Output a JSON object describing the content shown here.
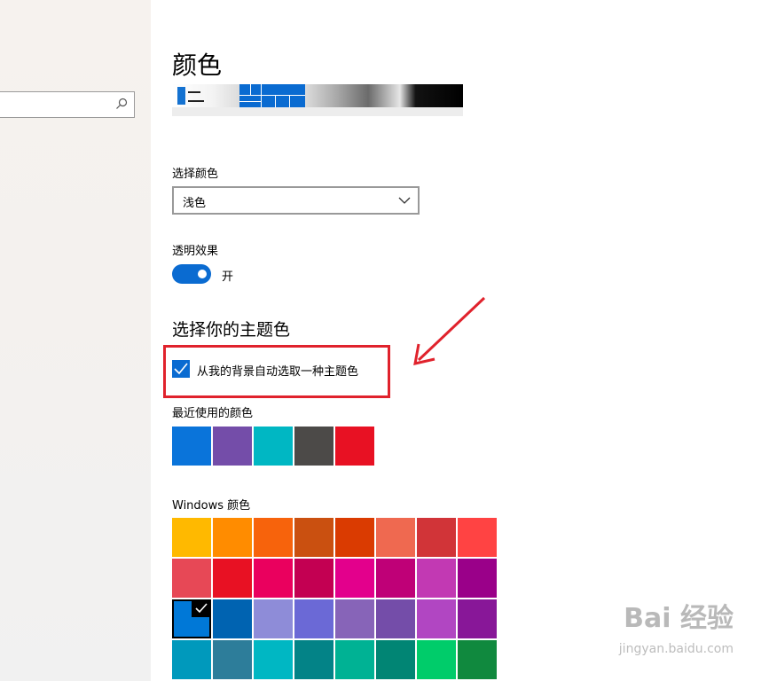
{
  "page": {
    "title": "颜色",
    "choose_color_label": "选择颜色",
    "choose_color_value": "浅色",
    "transparency_label": "透明效果",
    "transparency_state": "开",
    "accent_section_title": "选择你的主题色",
    "auto_accent_label": "从我的背景自动选取一种主题色",
    "recent_colors_label": "最近使用的颜色",
    "windows_colors_label": "Windows 颜色"
  },
  "recent_colors": [
    "#0a74da",
    "#744da9",
    "#00b7c3",
    "#4c4a48",
    "#e81123"
  ],
  "windows_colors": [
    "#ffb900",
    "#ff8c00",
    "#f7630c",
    "#ca5010",
    "#da3b01",
    "#ef6950",
    "#d13438",
    "#ff4343",
    "#e74856",
    "#e81123",
    "#ea005e",
    "#c30052",
    "#e3008c",
    "#bf0077",
    "#c239b3",
    "#9a0089",
    "#0078d7",
    "#0063b1",
    "#8e8cd8",
    "#6b69d6",
    "#8764b8",
    "#744da9",
    "#b146c2",
    "#881798",
    "#0099bc",
    "#2d7d9a",
    "#00b7c3",
    "#038387",
    "#00b294",
    "#018574",
    "#00cc6a",
    "#10893e"
  ],
  "selected_windows_color_index": 16,
  "accent_color": "#0a6bd1",
  "watermark": {
    "text": "Bai 经验",
    "sub": "jingyan.baidu.com"
  }
}
